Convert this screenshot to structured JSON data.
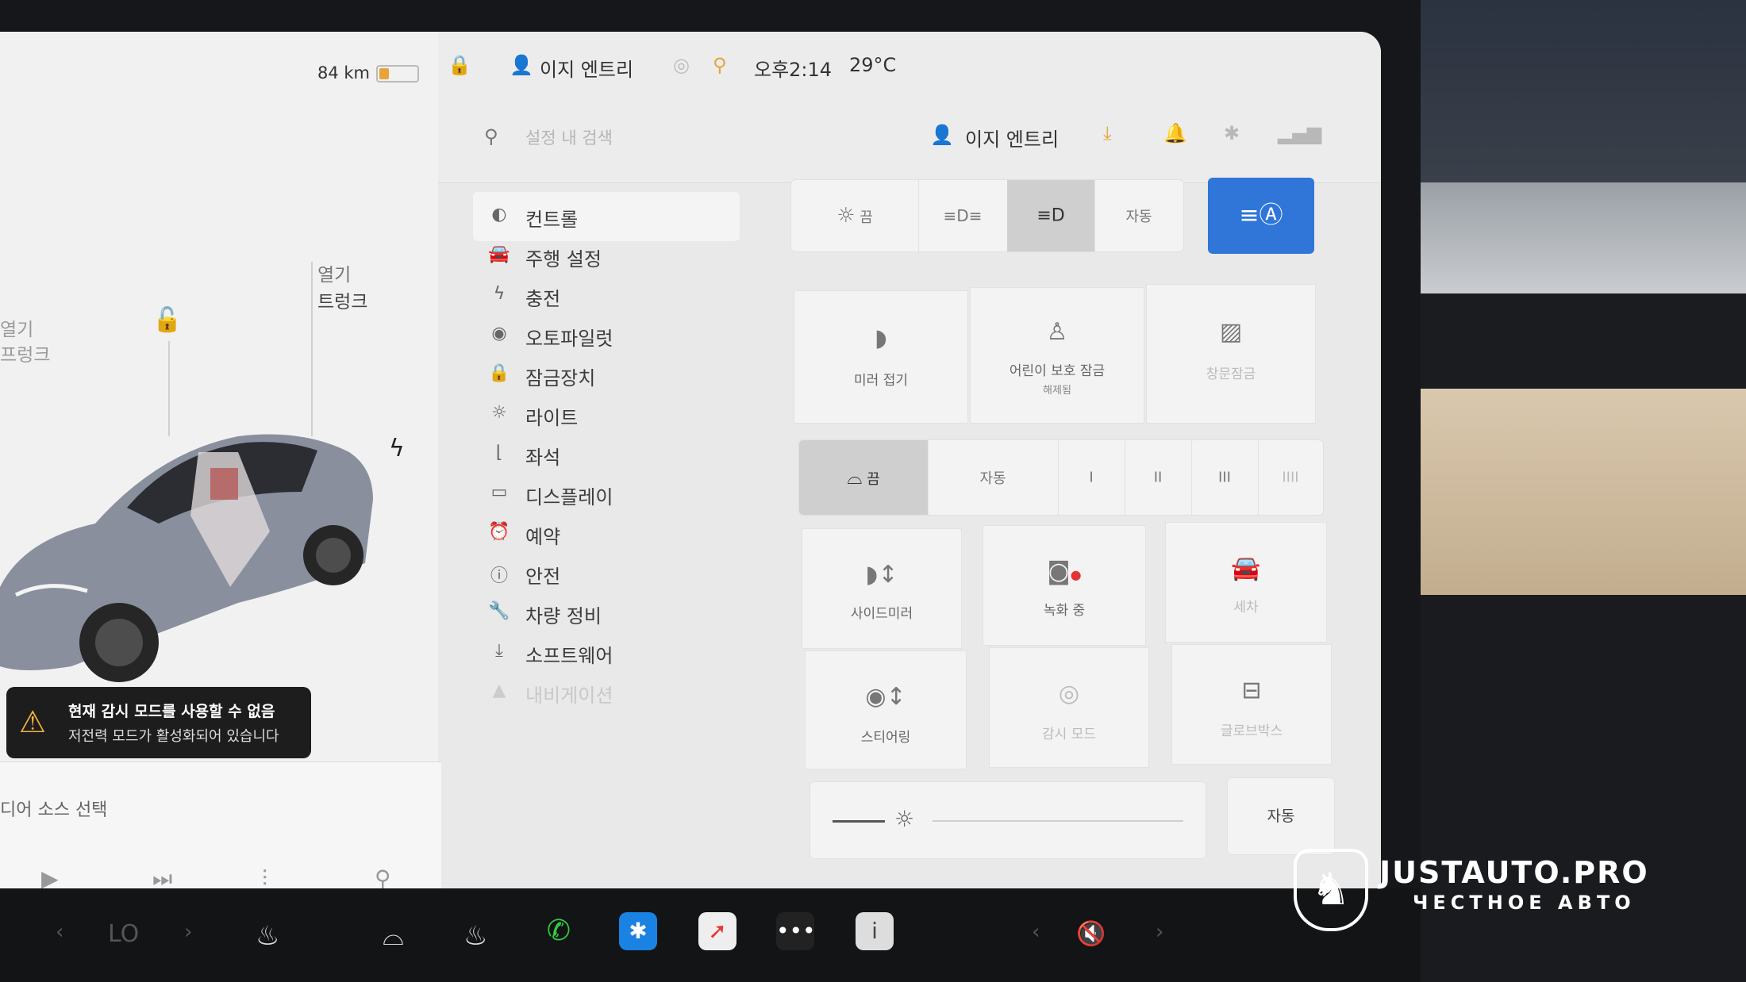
{
  "status_bar": {
    "range": "84 km",
    "battery_level": 0.25,
    "profile": "이지 엔트리",
    "time": "오후2:14",
    "temperature": "29°C"
  },
  "vehicle": {
    "trunk_open": "열기",
    "trunk": "트렁크",
    "frunk_open": "열기",
    "frunk": "프렁크"
  },
  "alert": {
    "title": "현재 감시 모드를 사용할 수 없음",
    "message": "저전력 모드가 활성화되어 있습니다"
  },
  "media": {
    "source": "디어 소스 선택"
  },
  "settings_header": {
    "search_placeholder": "설정 내 검색",
    "profile": "이지 엔트리"
  },
  "nav": {
    "items": [
      {
        "label": "컨트롤",
        "icon": "toggle-icon"
      },
      {
        "label": "주행 설정",
        "icon": "car-icon"
      },
      {
        "label": "충전",
        "icon": "bolt-icon"
      },
      {
        "label": "오토파일럿",
        "icon": "steering-wheel-icon"
      },
      {
        "label": "잠금장치",
        "icon": "lock-icon"
      },
      {
        "label": "라이트",
        "icon": "sun-icon"
      },
      {
        "label": "좌석",
        "icon": "seat-icon"
      },
      {
        "label": "디스플레이",
        "icon": "display-icon"
      },
      {
        "label": "예약",
        "icon": "alarm-icon"
      },
      {
        "label": "안전",
        "icon": "info-icon"
      },
      {
        "label": "차량 정비",
        "icon": "wrench-icon"
      },
      {
        "label": "소프트웨어",
        "icon": "download-icon"
      },
      {
        "label": "내비게이션",
        "icon": "navigation-icon"
      }
    ]
  },
  "lights": {
    "off": "끔",
    "auto": "자동"
  },
  "tiles": {
    "mirror_fold": "미러 접기",
    "child_lock": "어린이 보호 잠금",
    "child_lock_status": "해제됨",
    "window_lock": "창문잠금",
    "side_mirror": "사이드미러",
    "recording": "녹화 중",
    "car_wash": "세차",
    "steering": "스티어링",
    "sentry_mode": "감시 모드",
    "glovebox": "글로브박스"
  },
  "wipers": {
    "off": "끔",
    "auto": "자동",
    "speeds": [
      "I",
      "II",
      "III",
      "IIII"
    ]
  },
  "brightness": {
    "level": 0.15,
    "auto": "자동"
  },
  "dock": {
    "climate_temp": "LO"
  },
  "watermark": {
    "brand": "JUSTAUTO.PRO",
    "tagline": "ЧЕСТНОЕ АВТО"
  },
  "colors": {
    "accent_blue": "#2f76d8",
    "warning": "#f2b33c",
    "battery": "#e8a33a",
    "recording_dot": "#e33333"
  }
}
